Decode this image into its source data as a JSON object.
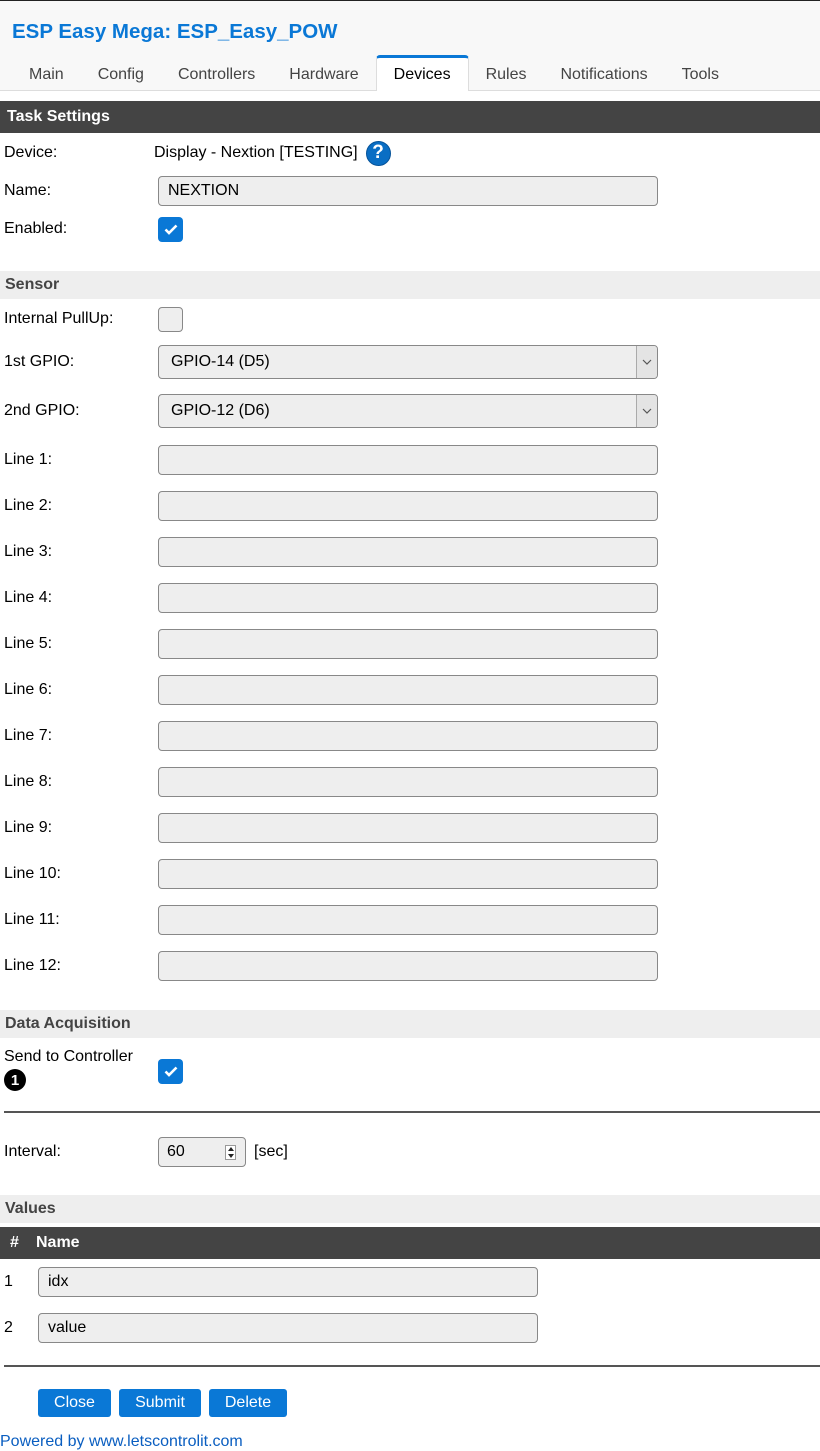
{
  "header": {
    "title": "ESP Easy Mega: ESP_Easy_POW",
    "accent_color": "#0a78d6"
  },
  "tabs": [
    {
      "label": "Main",
      "active": false
    },
    {
      "label": "Config",
      "active": false
    },
    {
      "label": "Controllers",
      "active": false
    },
    {
      "label": "Hardware",
      "active": false
    },
    {
      "label": "Devices",
      "active": true
    },
    {
      "label": "Rules",
      "active": false
    },
    {
      "label": "Notifications",
      "active": false
    },
    {
      "label": "Tools",
      "active": false
    }
  ],
  "task_settings": {
    "heading": "Task Settings",
    "device_label": "Device:",
    "device_value": "Display - Nextion [TESTING]",
    "help_icon": "question-mark-icon",
    "help_glyph": "?",
    "name_label": "Name:",
    "name_value": "NEXTION",
    "enabled_label": "Enabled:",
    "enabled": true
  },
  "sensor": {
    "heading": "Sensor",
    "pullup_label": "Internal PullUp:",
    "pullup": false,
    "gpio1_label": "1st GPIO:",
    "gpio1_value": "GPIO-14 (D5)",
    "gpio2_label": "2nd GPIO:",
    "gpio2_value": "GPIO-12 (D6)",
    "lines": [
      {
        "label": "Line 1:",
        "value": ""
      },
      {
        "label": "Line 2:",
        "value": ""
      },
      {
        "label": "Line 3:",
        "value": ""
      },
      {
        "label": "Line 4:",
        "value": ""
      },
      {
        "label": "Line 5:",
        "value": ""
      },
      {
        "label": "Line 6:",
        "value": ""
      },
      {
        "label": "Line 7:",
        "value": ""
      },
      {
        "label": "Line 8:",
        "value": ""
      },
      {
        "label": "Line 9:",
        "value": ""
      },
      {
        "label": "Line 10:",
        "value": ""
      },
      {
        "label": "Line 11:",
        "value": ""
      },
      {
        "label": "Line 12:",
        "value": ""
      }
    ]
  },
  "data_acquisition": {
    "heading": "Data Acquisition",
    "send_label": "Send to Controller",
    "controller_badge": "1",
    "send_enabled": true,
    "interval_label": "Interval:",
    "interval_value": "60",
    "interval_unit": "[sec]"
  },
  "values": {
    "heading": "Values",
    "col_num": "#",
    "col_name": "Name",
    "rows": [
      {
        "num": "1",
        "name": "idx"
      },
      {
        "num": "2",
        "name": "value"
      }
    ]
  },
  "buttons": {
    "close": "Close",
    "submit": "Submit",
    "delete": "Delete"
  },
  "footer": {
    "link_text": "Powered by www.letscontrolit.com"
  }
}
